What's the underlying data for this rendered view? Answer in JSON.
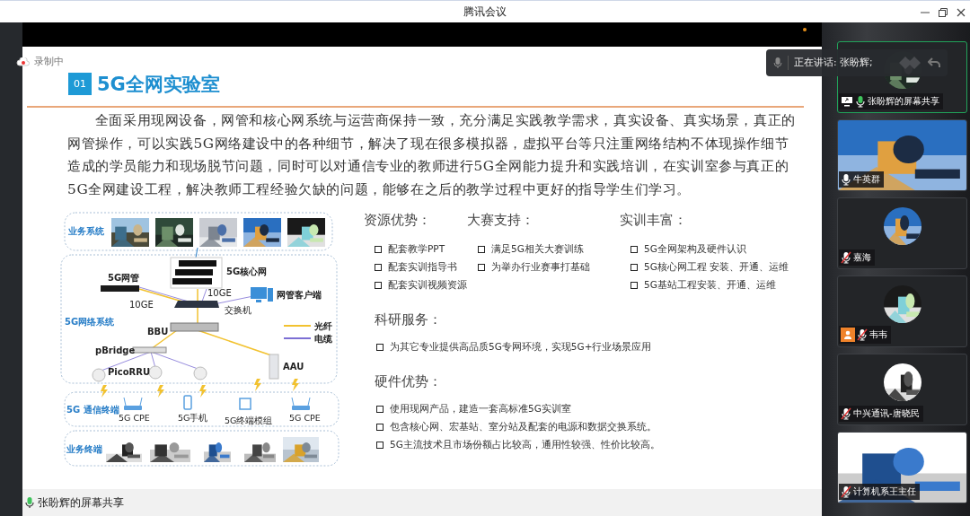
{
  "window": {
    "title": "腾讯会议"
  },
  "recording": {
    "label": "录制中"
  },
  "slide": {
    "number": "01",
    "title": "5G全网实验室",
    "paragraph": "全面采用现网设备，网管和核心网系统与运营商保持一致，充分满足实践教学需求，真实设备、真实场景，真正的网管操作，可以实践5G网络建设中的各种细节，解决了现在很多模拟器，虚拟平台等只注重网络结构不体现操作细节造成的学员能力和现场脱节问题，同时可以对通信专业的教师进行5G全网能力提升和实践培训，在实训室参与真正的5G全网建设工程，解决教师工程经验欠缺的问题，能够在之后的教学过程中更好的指导学生们学习。",
    "diagram": {
      "zones": [
        "业务系统",
        "5G网络系统",
        "5G 通信终端",
        "业务终端"
      ],
      "labels": [
        "5G网管",
        "5G核心网",
        "10GE",
        "10GE",
        "网管客户端",
        "交换机",
        "BBU",
        "pBridge",
        "PicoRRU",
        "AAU"
      ],
      "legend": [
        {
          "label": "光纤",
          "color": "#f2c230"
        },
        {
          "label": "电缆",
          "color": "#7c6fd4"
        }
      ],
      "terminals": [
        "5G CPE",
        "5G手机",
        "5G终端模组",
        "5G CPE"
      ]
    },
    "feature_columns": [
      {
        "heading": "资源优势：",
        "items": [
          "配套教学PPT",
          "配套实训指导书",
          "配套实训视频资源"
        ]
      },
      {
        "heading": "大赛支持：",
        "items": [
          "满足5G相关大赛训练",
          "为举办行业赛事打基础"
        ]
      },
      {
        "heading": "实训丰富：",
        "items": [
          "5G全网架构及硬件认识",
          "5G核心网工程 安装、开通、运维",
          "5G基站工程安装、开通、运维"
        ]
      }
    ],
    "feature_blocks": [
      {
        "heading": "科研服务：",
        "items": [
          "为其它专业提供高品质5G专网环境，实现5G+行业场景应用"
        ]
      },
      {
        "heading": "硬件优势：",
        "items": [
          "使用现网产品，建造一套高标准5G实训室",
          "包含核心网、宏基站、室分站及配套的电源和数据交换系统。",
          "5G主流技术且市场份额占比较高，通用性较强、性价比较高。"
        ]
      }
    ]
  },
  "speaking": {
    "label": "正在讲话: 张盼辉;"
  },
  "participants": [
    {
      "name": "张盼辉的屏幕共享",
      "kind": "avatar",
      "selected": true,
      "muted": false,
      "speaking": true,
      "sharing": true,
      "badge": false
    },
    {
      "name": "牛英群",
      "kind": "video",
      "selected": false,
      "muted": false,
      "speaking": false,
      "sharing": false,
      "badge": false
    },
    {
      "name": "嘉海",
      "kind": "avatar",
      "selected": false,
      "muted": true,
      "speaking": false,
      "sharing": false,
      "badge": false
    },
    {
      "name": "韦韦",
      "kind": "avatar",
      "selected": false,
      "muted": true,
      "speaking": false,
      "sharing": false,
      "badge": true
    },
    {
      "name": "中兴通讯-唐晓民",
      "kind": "avatar",
      "selected": false,
      "muted": true,
      "speaking": false,
      "sharing": false,
      "badge": false
    },
    {
      "name": "计算机系王主任",
      "kind": "video",
      "selected": false,
      "muted": true,
      "speaking": false,
      "sharing": false,
      "badge": false
    }
  ],
  "share_label": "张盼辉的屏幕共享"
}
